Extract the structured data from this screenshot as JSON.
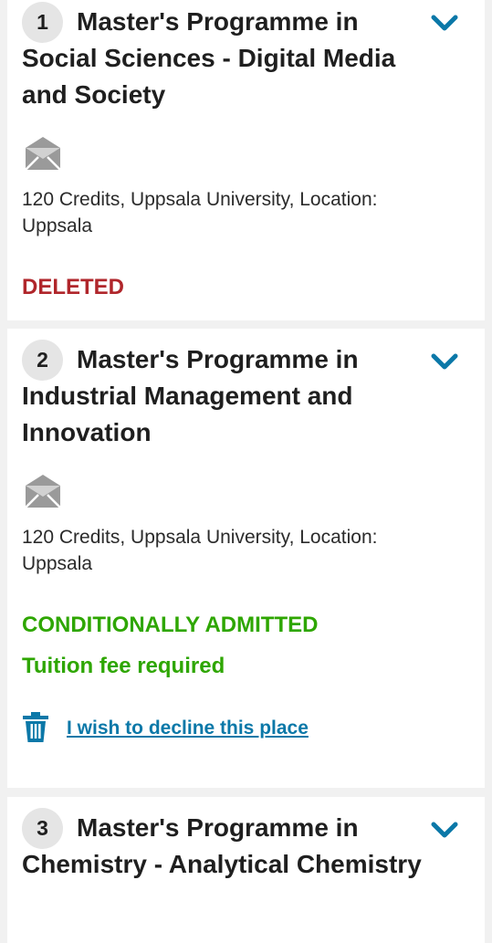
{
  "programmes": [
    {
      "number": "1",
      "title": "Master's Programme in Social Sciences - Digital Media and Society",
      "info": "120 Credits, Uppsala University, Location: Uppsala",
      "status": "DELETED",
      "icon": "envelope-icon"
    },
    {
      "number": "2",
      "title": "Master's Programme in Industrial Management and Innovation",
      "info": "120 Credits, Uppsala University, Location: Uppsala",
      "status": "CONDITIONALLY ADMITTED",
      "note": "Tuition fee required",
      "decline_label": "I wish to decline this place",
      "icon": "envelope-icon"
    },
    {
      "number": "3",
      "title": "Master's Programme in Chemistry - Analytical Chemistry"
    }
  ],
  "colors": {
    "deleted": "#b0262b",
    "admitted": "#2ea600",
    "accent": "#0b78a8",
    "icon_grey": "#9a9a9a",
    "badge_bg": "#e5e5e5"
  },
  "icons": {
    "expand": "chevron-down-icon",
    "mail": "envelope-icon",
    "decline": "trash-icon"
  }
}
